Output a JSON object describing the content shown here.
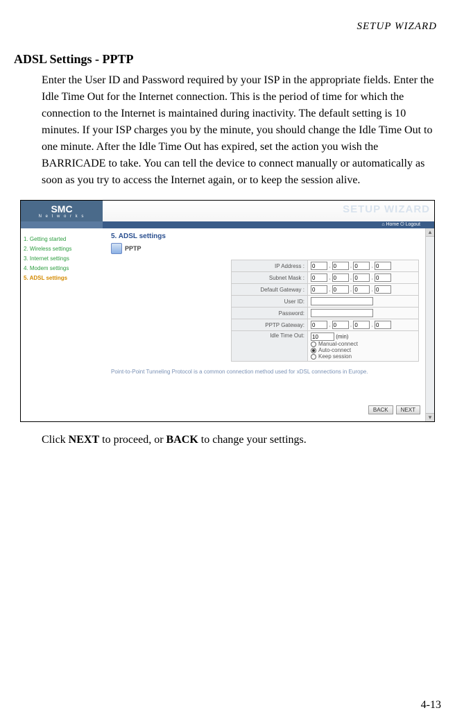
{
  "running_head": "SETUP WIZARD",
  "section_title": "ADSL Settings - PPTP",
  "paragraph": "Enter the User ID and Password required by your ISP in the appropriate fields. Enter the Idle Time Out for the Internet connection. This is the period of time for which the connection to the Internet is maintained during inactivity. The default setting is 10 minutes. If your ISP charges you by the minute, you should change the Idle Time Out to one minute. After the Idle Time Out has expired, set the action you wish the BARRICADE to take. You can tell the device to connect manually or automatically as soon as you try to access the Internet again, or to keep the session alive.",
  "footer_pre": "Click ",
  "footer_bold1": "NEXT",
  "footer_mid": " to proceed, or ",
  "footer_bold2": "BACK",
  "footer_post": " to change your settings.",
  "page_number": "4-13",
  "ui": {
    "logo_line1": "SMC",
    "logo_line2": "N e t w o r k s",
    "wizard_title": "SETUP WIZARD",
    "topbar_links": "⌂ Home   ⏻ Logout",
    "nav": {
      "n1": "1. Getting started",
      "n2": "2. Wireless settings",
      "n3": "3. Internet settings",
      "n4": "4. Modem settings",
      "n5": "5. ADSL settings"
    },
    "section_head": "5. ADSL settings",
    "pptp_label": "PPTP",
    "labels": {
      "ip": "IP Address :",
      "mask": "Subnet Mask :",
      "gw": "Default Gateway :",
      "uid": "User ID:",
      "pwd": "Password:",
      "pgw": "PPTP Gateway:",
      "idle": "Idle Time Out:"
    },
    "values": {
      "octet": "0",
      "idle_val": "10",
      "idle_unit": "(min)",
      "r1": "Manual-connect",
      "r2": "Auto-connect",
      "r3": "Keep session"
    },
    "note": "Point-to-Point Tunneling Protocol is a common connection method used for xDSL connections in Europe.",
    "btn_back": "BACK",
    "btn_next": "NEXT"
  }
}
